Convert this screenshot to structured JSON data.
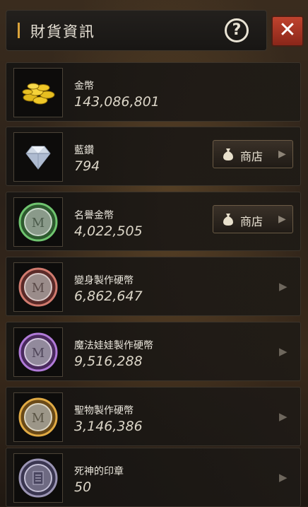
{
  "header": {
    "title": "財貨資訊",
    "help_label": "?",
    "close_label": "✕"
  },
  "currencies": [
    {
      "name": "金幣",
      "amount": "143,086,801",
      "icon": "gold-coins-icon",
      "has_shop": false,
      "has_arrow": false
    },
    {
      "name": "藍鑽",
      "amount": "794",
      "icon": "blue-diamond-icon",
      "has_shop": true,
      "shop_label": "商店",
      "has_arrow": false
    },
    {
      "name": "名譽金幣",
      "amount": "4,022,505",
      "icon": "honor-coin-icon",
      "has_shop": true,
      "shop_label": "商店",
      "has_arrow": false
    },
    {
      "name": "變身製作硬幣",
      "amount": "6,862,647",
      "icon": "transform-coin-icon",
      "has_shop": false,
      "has_arrow": true
    },
    {
      "name": "魔法娃娃製作硬幣",
      "amount": "9,516,288",
      "icon": "magic-doll-coin-icon",
      "has_shop": false,
      "has_arrow": true
    },
    {
      "name": "聖物製作硬幣",
      "amount": "3,146,386",
      "icon": "relic-coin-icon",
      "has_shop": false,
      "has_arrow": true
    },
    {
      "name": "死神的印章",
      "amount": "50",
      "icon": "death-seal-icon",
      "has_shop": false,
      "has_arrow": true
    }
  ],
  "colors": {
    "accent": "#d9a23a",
    "close_red": "#b23a28"
  }
}
